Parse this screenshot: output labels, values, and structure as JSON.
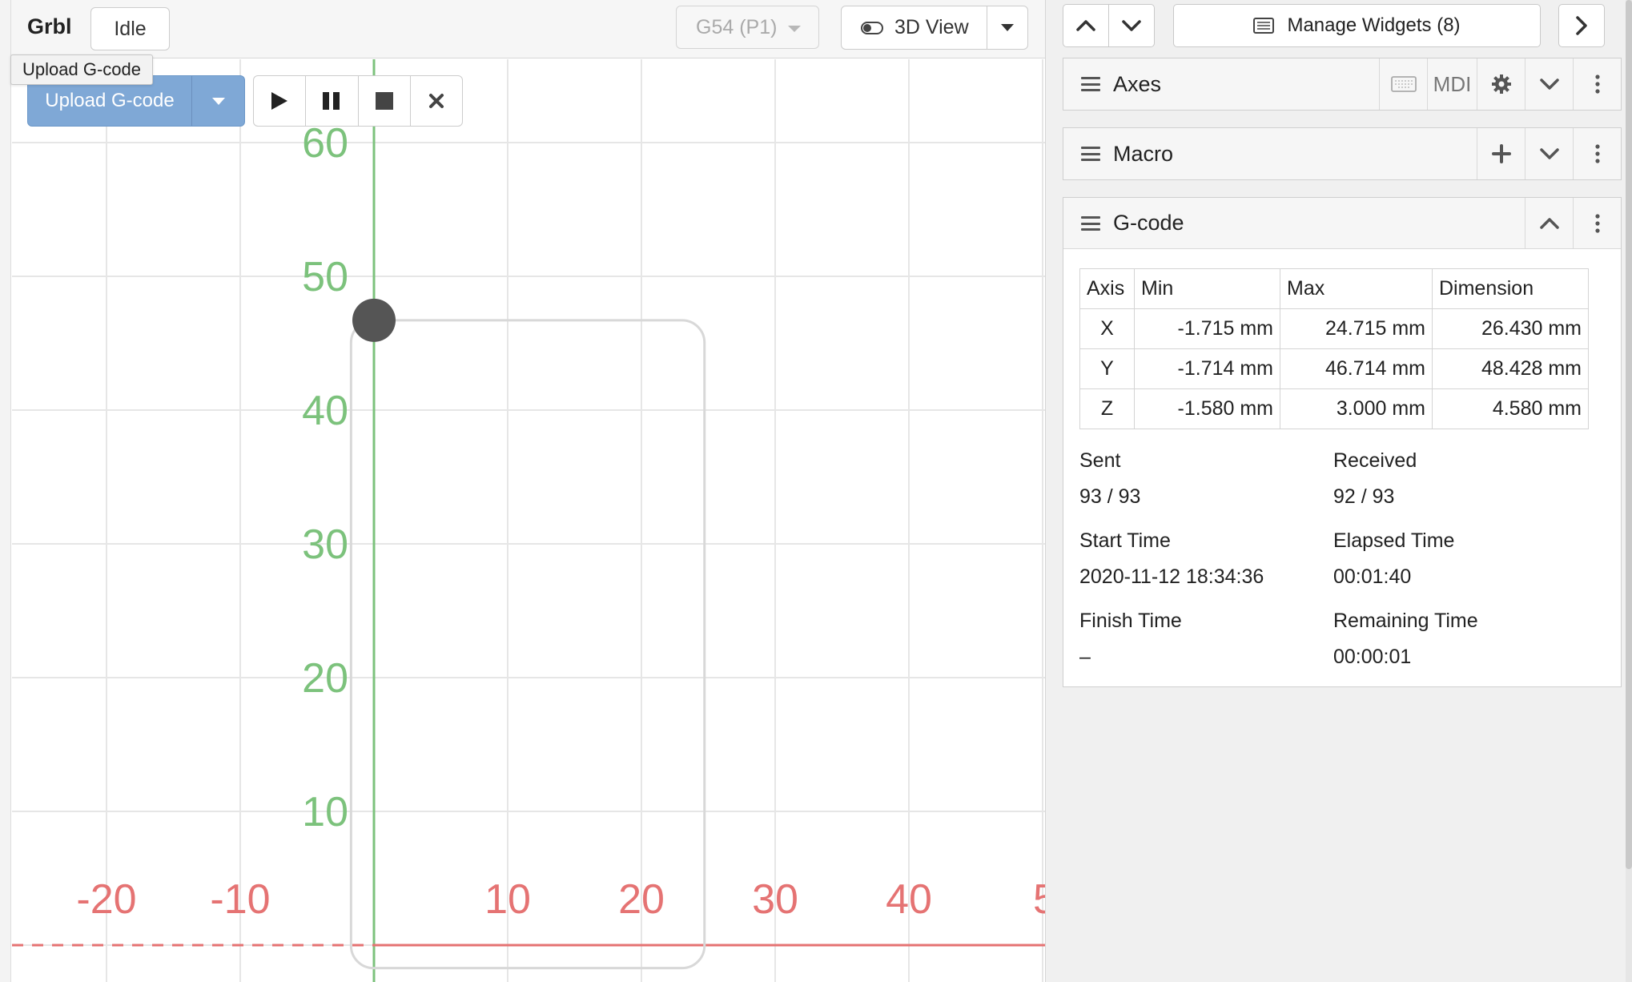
{
  "toolbar": {
    "controller_name": "Grbl",
    "controller_state": "Idle",
    "tooltip": "Upload G-code",
    "upload_label": "Upload G-code",
    "wcs_label": "G54 (P1)",
    "view_label": "3D View"
  },
  "visualizer": {
    "x_ticks": [
      -20,
      -10,
      10,
      20,
      30,
      40,
      5
    ],
    "y_ticks": [
      10,
      20,
      30,
      40,
      50,
      60
    ],
    "toolpath_bounds": {
      "xmin": -1.715,
      "xmax": 24.715,
      "ymin": -1.714,
      "ymax": 46.714
    },
    "tool_position": {
      "x": 0,
      "y": 46.714
    },
    "colors": {
      "x_axis": "#e57373",
      "y_axis": "#7cc27c",
      "grid": "#e6e6e6",
      "toolpath": "#d8d8d8",
      "tool": "#555555"
    }
  },
  "sidebar": {
    "manage_widgets_label": "Manage Widgets (8)",
    "axes": {
      "title": "Axes",
      "mdi_label": "MDI"
    },
    "macro": {
      "title": "Macro"
    },
    "gcode": {
      "title": "G-code",
      "columns": [
        "Axis",
        "Min",
        "Max",
        "Dimension"
      ],
      "rows": [
        {
          "axis": "X",
          "min": "-1.715 mm",
          "max": "24.715 mm",
          "dimension": "26.430 mm"
        },
        {
          "axis": "Y",
          "min": "-1.714 mm",
          "max": "46.714 mm",
          "dimension": "48.428 mm"
        },
        {
          "axis": "Z",
          "min": "-1.580 mm",
          "max": "3.000 mm",
          "dimension": "4.580 mm"
        }
      ],
      "sent_label": "Sent",
      "sent_value": "93 / 93",
      "received_label": "Received",
      "received_value": "92 / 93",
      "start_time_label": "Start Time",
      "start_time_value": "2020-11-12 18:34:36",
      "elapsed_time_label": "Elapsed Time",
      "elapsed_time_value": "00:01:40",
      "finish_time_label": "Finish Time",
      "finish_time_value": "–",
      "remaining_time_label": "Remaining Time",
      "remaining_time_value": "00:00:01"
    }
  }
}
